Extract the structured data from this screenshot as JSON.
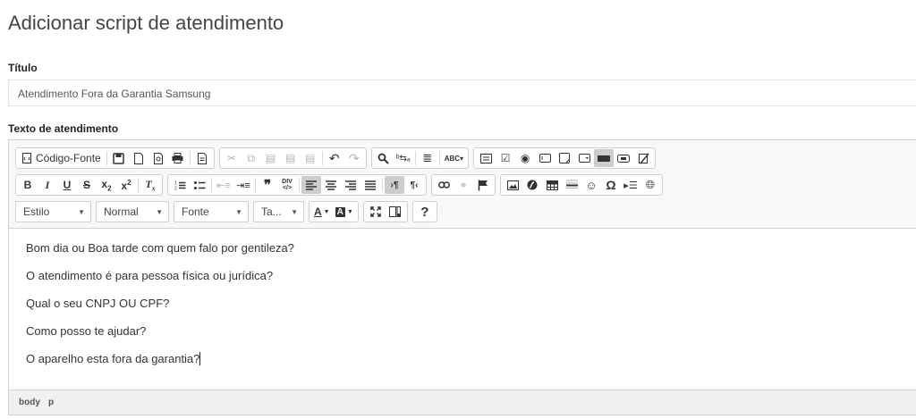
{
  "page": {
    "title": "Adicionar script de atendimento"
  },
  "titulo": {
    "label": "Título",
    "value": "Atendimento Fora da Garantia Samsung"
  },
  "texto": {
    "label": "Texto de atendimento"
  },
  "toolbar": {
    "source_label": "Código-Fonte",
    "styles_combo": "Estilo",
    "format_combo": "Normal",
    "font_combo": "Fonte",
    "size_combo": "Ta...",
    "help_label": "?"
  },
  "editor": {
    "paragraphs": [
      "Bom dia ou Boa tarde com quem falo por gentileza?",
      "O atendimento é para pessoa física ou jurídica?",
      "Qual o seu CNPJ OU CPF?",
      "Como posso te ajudar?",
      "O aparelho esta fora da garantia?"
    ],
    "path": [
      "body",
      "p"
    ]
  },
  "icons": {
    "row1": [
      "source-icon",
      "save-icon",
      "new-page-icon",
      "preview-icon",
      "print-icon",
      "templates-icon",
      "cut-icon",
      "copy-icon",
      "paste-icon",
      "paste-text-icon",
      "paste-word-icon",
      "undo-icon",
      "redo-icon",
      "find-icon",
      "replace-icon",
      "select-all-icon",
      "spellcheck-icon",
      "form-icon",
      "checkbox-icon",
      "radio-icon",
      "textfield-icon",
      "textarea-icon",
      "select-icon",
      "button-icon",
      "image-button-icon",
      "hidden-field-icon"
    ],
    "row2": [
      "bold-icon",
      "italic-icon",
      "underline-icon",
      "strike-icon",
      "subscript-icon",
      "superscript-icon",
      "remove-format-icon",
      "numbered-list-icon",
      "bulleted-list-icon",
      "outdent-icon",
      "indent-icon",
      "blockquote-icon",
      "div-icon",
      "align-left-icon",
      "align-center-icon",
      "align-right-icon",
      "justify-icon",
      "ltr-icon",
      "rtl-icon",
      "link-icon",
      "unlink-icon",
      "anchor-icon",
      "image-icon",
      "flash-icon",
      "table-icon",
      "horizontal-rule-icon",
      "smiley-icon",
      "special-char-icon",
      "page-break-icon",
      "iframe-icon"
    ]
  }
}
